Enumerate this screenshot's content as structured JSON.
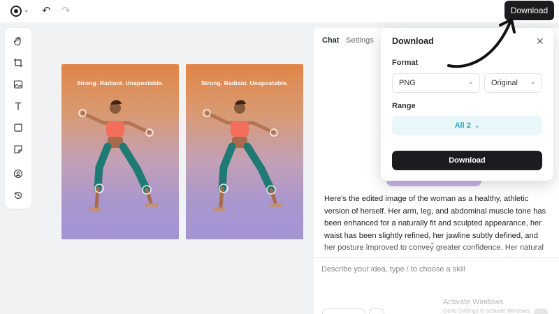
{
  "topbar": {
    "download_label": "Download"
  },
  "canvas": {
    "images": [
      {
        "caption": "Strong. Radiant. Unspostable."
      },
      {
        "caption": "Strong. Radiant. Unspostable."
      }
    ]
  },
  "panel": {
    "tabs": [
      {
        "label": "Chat",
        "active": true
      },
      {
        "label": "Settings",
        "active": false
      }
    ],
    "response_text": "Here's the edited image of the woman as a healthy, athletic version of herself. Her arm, leg, and abdominal muscle tone has been enhanced for a naturally fit and sculpted appearance, her waist has been slightly refined, her jawline subtly defined, and her posture improved to convey greater confidence. Her natural facial features, hair, and skin tone remain unchanged, and all other original",
    "input_placeholder": "Describe your idea, type / to choose a skill"
  },
  "download_popover": {
    "title": "Download",
    "format_label": "Format",
    "format_value": "PNG",
    "size_value": "Original",
    "range_label": "Range",
    "range_value": "All 2",
    "download_button": "Download"
  },
  "watermark": {
    "line1": "Activate Windows",
    "line2": "Go to Settings to activate Windows."
  },
  "colors": {
    "accent": "#18aebd",
    "button_dark": "#1c1c1e"
  }
}
